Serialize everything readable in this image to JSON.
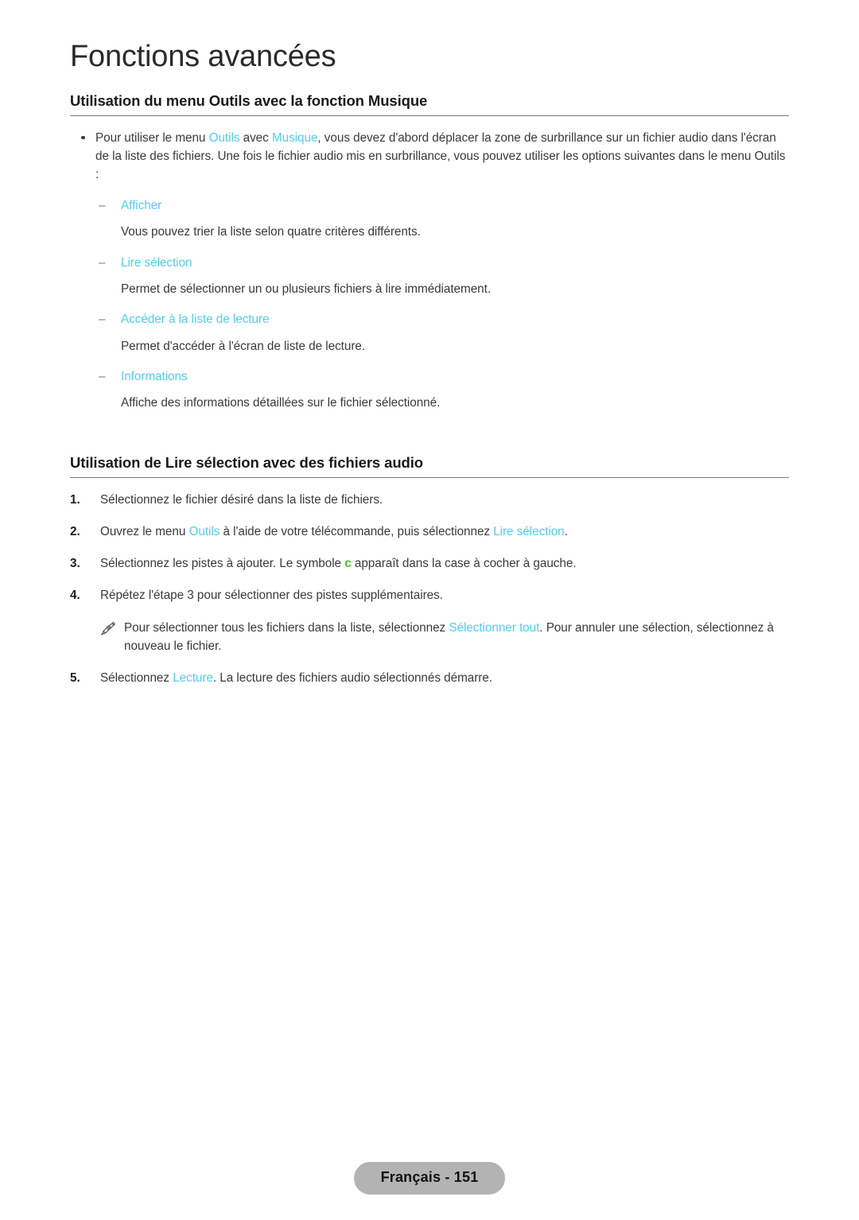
{
  "page": {
    "chapter_title": "Fonctions avancées",
    "footer_label": "Français - 151"
  },
  "colors": {
    "link_cyan": "#53cdf0",
    "check_green": "#3ecc22",
    "heading_rule": "#7a7a7a",
    "footer_badge_bg": "#b3b3b3"
  },
  "section_1": {
    "heading": "Utilisation du menu Outils avec la fonction Musique",
    "intro": {
      "part_1": "Pour utiliser le menu ",
      "link_1": "Outils",
      "part_2": " avec ",
      "link_2": "Musique",
      "part_3": ", vous devez d'abord déplacer la zone de surbrillance sur un fichier audio dans l'écran de la liste des fichiers. Une fois le fichier audio mis en surbrillance, vous pouvez utiliser les options suivantes dans le menu Outils :"
    },
    "dash_mark": "–",
    "options": [
      {
        "label": "Afficher",
        "description": "Vous pouvez trier la liste selon quatre critères différents."
      },
      {
        "label": "Lire sélection",
        "description": "Permet de sélectionner un ou plusieurs fichiers à lire immédiatement."
      },
      {
        "label": "Accéder à la liste de lecture",
        "description": "Permet d'accéder à l'écran de liste de lecture."
      },
      {
        "label": "Informations",
        "description": "Affiche des informations détaillées sur le fichier sélectionné."
      }
    ]
  },
  "section_2": {
    "heading": "Utilisation de Lire sélection avec des fichiers audio",
    "steps": {
      "n1": "1.",
      "n2": "2.",
      "n3": "3.",
      "n4": "4.",
      "n5": "5."
    },
    "step_1": "Sélectionnez le fichier désiré dans la liste de fichiers.",
    "step_2": {
      "part_1": "Ouvrez le menu ",
      "link_1": "Outils",
      "part_2": " à l'aide de votre télécommande, puis sélectionnez ",
      "link_2": "Lire sélection",
      "part_3": "."
    },
    "step_3": {
      "part_1": "Sélectionnez les pistes à ajouter. Le symbole ",
      "symbol": "c",
      "part_2": " apparaît dans la case à cocher à gauche."
    },
    "step_4": "Répétez l'étape 3 pour sélectionner des pistes supplémentaires.",
    "note": {
      "part_1": "Pour sélectionner tous les fichiers dans la liste, sélectionnez ",
      "link_1": "Sélectionner tout",
      "part_2": ". Pour annuler une sélection, sélectionnez à nouveau le fichier."
    },
    "step_5": {
      "part_1": "Sélectionnez ",
      "link_1": "Lecture",
      "part_2": ". La lecture des fichiers audio sélectionnés démarre."
    }
  }
}
